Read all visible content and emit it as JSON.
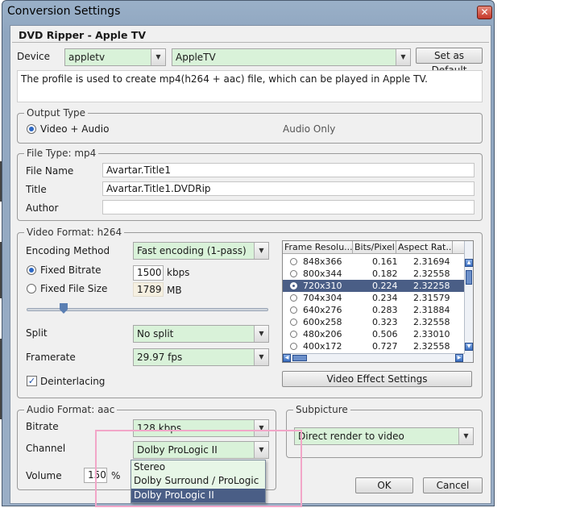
{
  "window": {
    "title": "Conversion Settings",
    "close_glyph": "✕",
    "header": "DVD Ripper - Apple TV"
  },
  "device": {
    "label": "Device",
    "value": "appletv",
    "profile": "AppleTV",
    "set_default_label": "Set as Default",
    "description": "The profile is used to create mp4(h264 + aac) file, which can be played in Apple TV."
  },
  "output_type": {
    "legend": "Output Type",
    "option_video_audio": "Video + Audio",
    "option_audio_only": "Audio Only",
    "selected": "Video + Audio"
  },
  "file_type": {
    "legend": "File Type: mp4",
    "file_name_label": "File Name",
    "file_name_value": "Avartar.Title1",
    "title_label": "Title",
    "title_value": "Avartar.Title1.DVDRip",
    "author_label": "Author",
    "author_value": ""
  },
  "video_format": {
    "legend": "Video Format: h264",
    "encoding_label": "Encoding Method",
    "encoding_value": "Fast encoding (1-pass)",
    "fixed_bitrate_label": "Fixed Bitrate",
    "fixed_bitrate_value": "1500",
    "fixed_bitrate_unit": "kbps",
    "fixed_size_label": "Fixed File Size",
    "fixed_size_value": "1789",
    "fixed_size_unit": "MB",
    "split_label": "Split",
    "split_value": "No split",
    "framerate_label": "Framerate",
    "framerate_value": "29.97 fps",
    "deinterlacing_label": "Deinterlacing",
    "deinterlacing_checked": true,
    "effect_button": "Video Effect Settings"
  },
  "resolution_table": {
    "headers": [
      "Frame Resolu...",
      "Bits/Pixel",
      "Aspect Rat..."
    ],
    "rows": [
      {
        "res": "848x366",
        "bpp": "0.161",
        "aspect": "2.31694",
        "selected": false
      },
      {
        "res": "800x344",
        "bpp": "0.182",
        "aspect": "2.32558",
        "selected": false
      },
      {
        "res": "720x310",
        "bpp": "0.224",
        "aspect": "2.32258",
        "selected": true
      },
      {
        "res": "704x304",
        "bpp": "0.234",
        "aspect": "2.31579",
        "selected": false
      },
      {
        "res": "640x276",
        "bpp": "0.283",
        "aspect": "2.31884",
        "selected": false
      },
      {
        "res": "600x258",
        "bpp": "0.323",
        "aspect": "2.32558",
        "selected": false
      },
      {
        "res": "480x206",
        "bpp": "0.506",
        "aspect": "2.33010",
        "selected": false
      },
      {
        "res": "400x172",
        "bpp": "0.727",
        "aspect": "2.32558",
        "selected": false
      }
    ]
  },
  "audio_format": {
    "legend": "Audio Format: aac",
    "bitrate_label": "Bitrate",
    "bitrate_value": "128 kbps",
    "channel_label": "Channel",
    "channel_value": "Dolby ProLogic II",
    "channel_options": [
      "Stereo",
      "Dolby Surround / ProLogic",
      "Dolby ProLogic II"
    ],
    "volume_label": "Volume",
    "volume_value": "150",
    "volume_unit": "%"
  },
  "subpicture": {
    "legend": "Subpicture",
    "value": "Direct render to video"
  },
  "buttons": {
    "ok": "OK",
    "cancel": "Cancel"
  },
  "colors": {
    "combo_green": "#d9f2d9",
    "selection": "#4a5e86",
    "highlight_box": "#f2a6c8"
  }
}
